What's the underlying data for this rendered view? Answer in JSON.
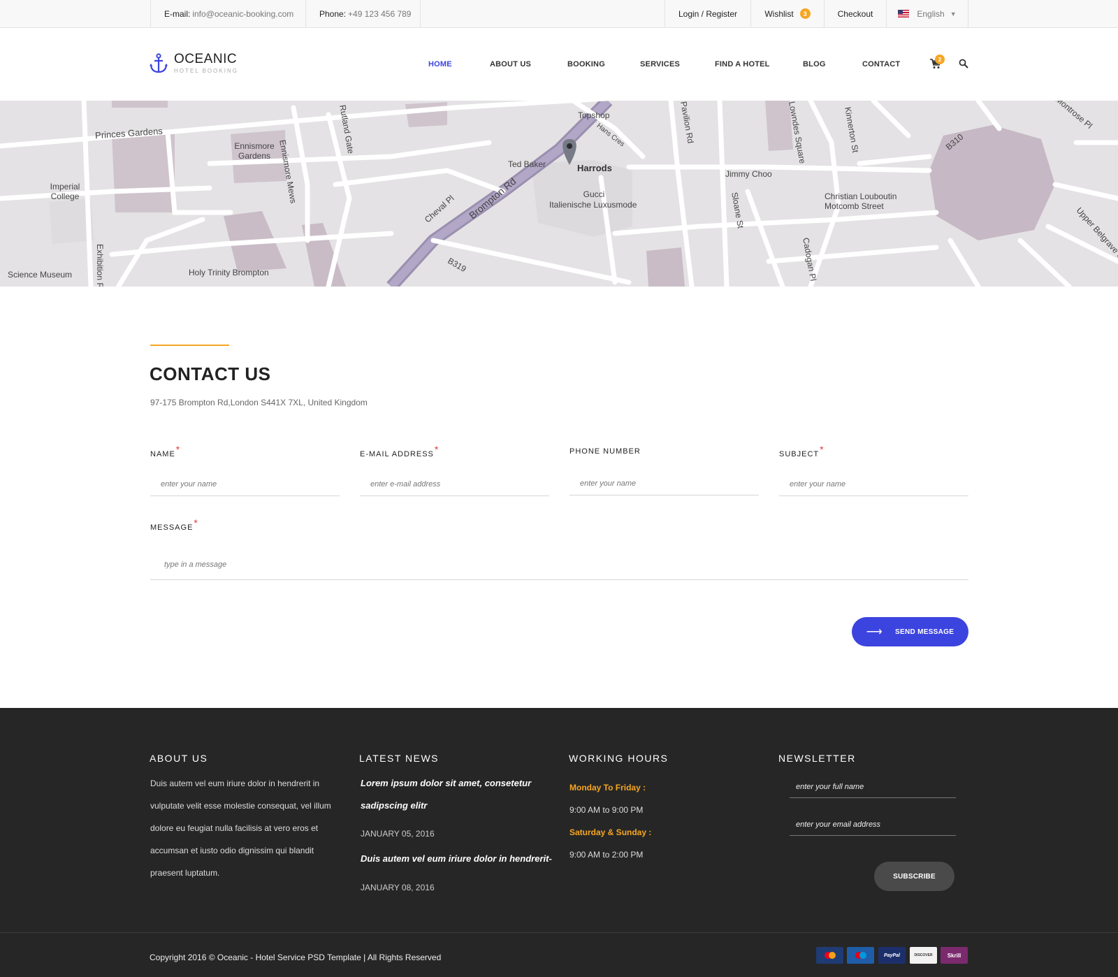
{
  "topbar": {
    "email_label": "E-mail:",
    "email_value": "info@oceanic-booking.com",
    "phone_label": "Phone:",
    "phone_value": "+49 123 456 789",
    "login_register": "Login / Register",
    "wishlist_label": "Wishlist",
    "wishlist_count": "3",
    "checkout_label": "Checkout",
    "language": "English"
  },
  "header": {
    "logo_name": "OCEANIC",
    "logo_tagline": "HOTEL BOOKING",
    "nav": [
      "HOME",
      "ABOUT US",
      "BOOKING",
      "SERVICES",
      "FIND A HOTEL",
      "BLOG",
      "CONTACT"
    ],
    "active_nav": "HOME",
    "cart_count": "2"
  },
  "map": {
    "labels": [
      "Princes Gardens",
      "Ennismore Gardens",
      "Imperial College",
      "Ennismore Mews",
      "Rutland Gate",
      "Topshop",
      "Hans Cres",
      "Ted Baker",
      "Harrods",
      "Gucci",
      "Italienische Luxusmode",
      "Cheval Pl",
      "Brompton Rd",
      "Jimmy Choo",
      "Christian Louboutin",
      "Motcomb Street",
      "Sloane St",
      "Pavilion Rd",
      "Kinnerton St",
      "Lowndes Square",
      "B310",
      "Montrose Pl",
      "Upper Belgrave St",
      "Cadogan Pl",
      "B319",
      "Science Museum",
      "Holy Trinity Brompton",
      "Exhibition Rd"
    ]
  },
  "contact": {
    "title": "CONTACT US",
    "address": "97-175 Brompton Rd,London S441X 7XL, United Kingdom",
    "fields": {
      "name": {
        "label": "NAME",
        "placeholder": "enter your name"
      },
      "email": {
        "label": "E-MAIL ADDRESS",
        "placeholder": "enter e-mail address"
      },
      "phone": {
        "label": "PHONE NUMBER",
        "placeholder": "enter your name"
      },
      "subject": {
        "label": "SUBJECT",
        "placeholder": "enter your name"
      },
      "message": {
        "label": "MESSAGE",
        "placeholder": "type in a message"
      }
    },
    "required_mark": "*",
    "send_label": "SEND MESSAGE"
  },
  "footer": {
    "about": {
      "title": "ABOUT US",
      "text": "Duis autem vel eum iriure dolor in hendrerit in vulputate velit esse molestie consequat, vel illum dolore eu feugiat nulla facilisis at vero eros et accumsan et iusto odio dignissim qui blandit praesent luptatum."
    },
    "news": {
      "title": "LATEST NEWS",
      "items": [
        {
          "headline": "Lorem ipsum dolor sit amet, consetetur sadipscing elitr",
          "date": "JANUARY 05, 2016"
        },
        {
          "headline": "Duis autem vel eum iriure dolor in hendrerit-",
          "date": "JANUARY 08, 2016"
        }
      ]
    },
    "hours": {
      "title": "WORKING HOURS",
      "weekday_label": "Monday To Friday :",
      "weekday_hours": "9:00 AM to 9:00 PM",
      "weekend_label": "Saturday & Sunday :",
      "weekend_hours": "9:00 AM to 2:00 PM"
    },
    "newsletter": {
      "title": "NEWSLETTER",
      "name_placeholder": "enter your full name",
      "email_placeholder": "enter your email address",
      "subscribe_label": "SUBSCRIBE"
    },
    "copyright": "Copyright 2016 © Oceanic - Hotel Service PSD Template | All Rights Reserved",
    "payments": [
      "MasterCard",
      "Maestro",
      "PayPal",
      "DISCOVER",
      "Skrill"
    ]
  },
  "colors": {
    "accent_blue": "#3c44e0",
    "accent_orange": "#f6a623",
    "footer_bg": "#262626",
    "required_red": "#e43b3b"
  }
}
